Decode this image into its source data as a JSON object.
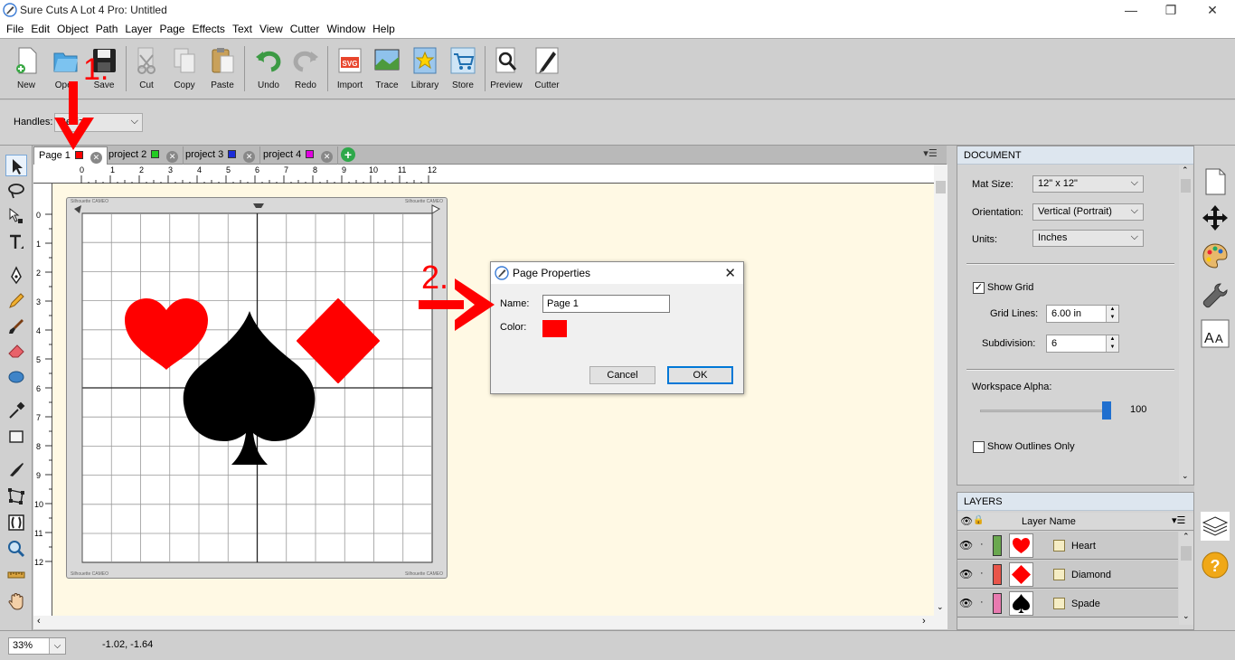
{
  "window": {
    "title": "Sure Cuts A Lot 4 Pro: Untitled",
    "controls": [
      "—",
      "❐",
      "✕"
    ]
  },
  "menu": [
    "File",
    "Edit",
    "Object",
    "Path",
    "Layer",
    "Page",
    "Effects",
    "Text",
    "View",
    "Cutter",
    "Window",
    "Help"
  ],
  "toolbar": {
    "new": "New",
    "open": "Open",
    "save": "Save",
    "cut": "Cut",
    "copy": "Copy",
    "paste": "Paste",
    "undo": "Undo",
    "redo": "Redo",
    "import": "Import",
    "trace": "Trace",
    "library": "Library",
    "store": "Store",
    "preview": "Preview",
    "cutter": "Cutter"
  },
  "propbar": {
    "handles_label": "Handles:",
    "handles_value": "Resize"
  },
  "tabs": [
    {
      "label": "Page 1",
      "color": "#ff0000"
    },
    {
      "label": "project 2",
      "color": "#22cc22"
    },
    {
      "label": "project 3",
      "color": "#1a2bd8"
    },
    {
      "label": "project 4",
      "color": "#e000e0"
    }
  ],
  "rulers": {
    "horizontal": [
      "0",
      "1",
      "2",
      "3",
      "4",
      "5",
      "6",
      "7",
      "8",
      "9",
      "10",
      "11",
      "12"
    ],
    "vertical": [
      "0",
      "1",
      "2",
      "3",
      "4",
      "5",
      "6",
      "7",
      "8",
      "9",
      "10",
      "11",
      "12"
    ]
  },
  "mat": {
    "brand_text": "Silhouette CAMEO"
  },
  "document_panel": {
    "header": "DOCUMENT",
    "mat_size_label": "Mat Size:",
    "mat_size_value": "12\" x 12\"",
    "orientation_label": "Orientation:",
    "orientation_value": "Vertical (Portrait)",
    "units_label": "Units:",
    "units_value": "Inches",
    "show_grid_label": "Show Grid",
    "show_grid_checked": true,
    "grid_lines_label": "Grid Lines:",
    "grid_lines_value": "6.00 in",
    "subdivision_label": "Subdivision:",
    "subdivision_value": "6",
    "workspace_alpha_label": "Workspace Alpha:",
    "workspace_alpha_value": "100",
    "show_outlines_label": "Show Outlines Only",
    "show_outlines_checked": false
  },
  "layers_panel": {
    "header": "LAYERS",
    "column_name": "Layer Name",
    "layers": [
      {
        "name": "Heart",
        "color": "#6aa84f"
      },
      {
        "name": "Diamond",
        "color": "#e8554a"
      },
      {
        "name": "Spade",
        "color": "#e87ab0"
      }
    ]
  },
  "status": {
    "zoom": "33%",
    "coords": "-1.02, -1.64"
  },
  "dialog": {
    "title": "Page Properties",
    "name_label": "Name:",
    "name_value": "Page 1",
    "color_label": "Color:",
    "color_value": "#ff0000",
    "cancel": "Cancel",
    "ok": "OK"
  },
  "annotations": {
    "step1": "1.",
    "step2": "2."
  },
  "colors": {
    "accent_red": "#ff0000",
    "workspace": "#fff9e4"
  }
}
